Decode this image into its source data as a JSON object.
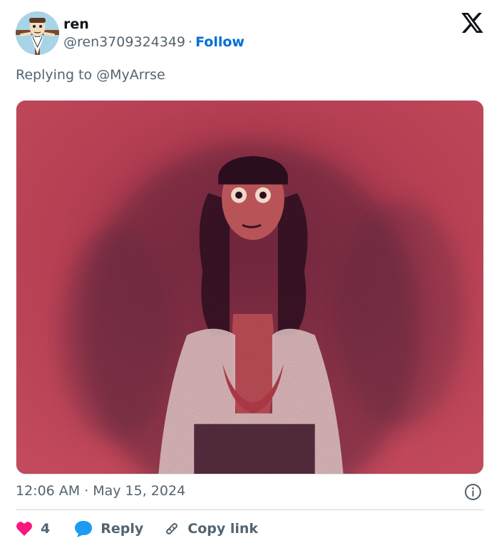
{
  "author": {
    "display_name": "ren",
    "handle": "@ren3709324349",
    "separator": "·",
    "follow_label": "Follow",
    "avatar_icon": "cartoon-avatar-icon"
  },
  "platform_icon": "x-logo-icon",
  "reply_context": "Replying to @MyArrse",
  "media": {
    "icon": "attached-image",
    "background_color": "#c73848"
  },
  "timestamp": {
    "time": "12:06 AM",
    "separator": "·",
    "date": "May 15, 2024"
  },
  "info_icon": "info-icon",
  "actions": {
    "likes_count": "4",
    "like_icon": "heart-icon",
    "like_color": "#f91880",
    "reply_label": "Reply",
    "reply_icon": "speech-bubble-icon",
    "reply_color": "#1d9bf0",
    "copy_label": "Copy link",
    "copy_icon": "link-icon"
  }
}
